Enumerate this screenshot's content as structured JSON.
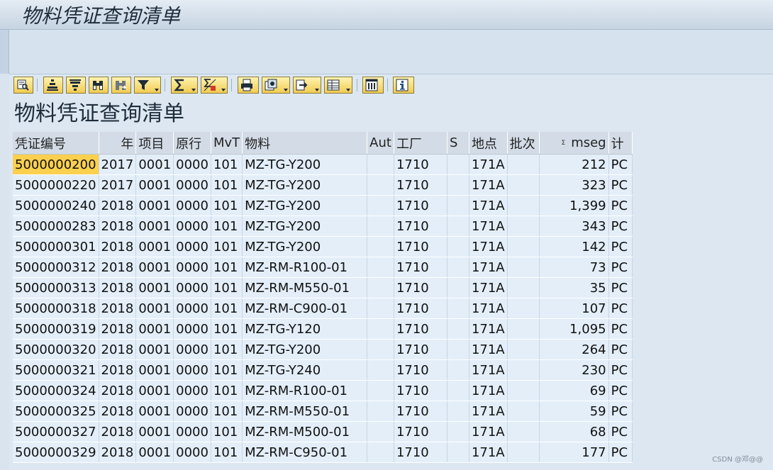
{
  "window": {
    "title": "物料凭证查询清单"
  },
  "report": {
    "title": "物料凭证查询清单"
  },
  "toolbar": {
    "buttons": [
      {
        "id": "details",
        "icon": "details-icon",
        "dropdown": false
      },
      {
        "id": "sort-asc",
        "icon": "sort-ascending-icon",
        "dropdown": false
      },
      {
        "id": "sort-desc",
        "icon": "sort-descending-icon",
        "dropdown": false
      },
      {
        "id": "find",
        "icon": "binoculars-icon",
        "dropdown": false
      },
      {
        "id": "find-next",
        "icon": "find-next-icon",
        "dropdown": false
      },
      {
        "id": "filter",
        "icon": "filter-icon",
        "dropdown": true
      },
      {
        "id": "total",
        "icon": "sum-icon",
        "dropdown": true
      },
      {
        "id": "subtotal",
        "icon": "subtotal-icon",
        "dropdown": true
      },
      {
        "id": "print",
        "icon": "print-icon",
        "dropdown": false
      },
      {
        "id": "views",
        "icon": "views-icon",
        "dropdown": true
      },
      {
        "id": "export",
        "icon": "export-icon",
        "dropdown": true
      },
      {
        "id": "layout",
        "icon": "layout-icon",
        "dropdown": true
      },
      {
        "id": "columns",
        "icon": "columns-icon",
        "dropdown": false
      },
      {
        "id": "info",
        "icon": "info-icon",
        "dropdown": false
      }
    ]
  },
  "table": {
    "columns": [
      "凭证编号",
      "年",
      "项目",
      "原行",
      "MvT",
      "物料",
      "Aut",
      "工厂",
      "S",
      "地点",
      "批次",
      "mseg",
      "计"
    ],
    "rows": [
      [
        "5000000200",
        "2017",
        "0001",
        "0000",
        "101",
        "MZ-TG-Y200",
        "",
        "1710",
        "",
        "171A",
        "",
        "212",
        "PC"
      ],
      [
        "5000000220",
        "2017",
        "0001",
        "0000",
        "101",
        "MZ-TG-Y200",
        "",
        "1710",
        "",
        "171A",
        "",
        "323",
        "PC"
      ],
      [
        "5000000240",
        "2018",
        "0001",
        "0000",
        "101",
        "MZ-TG-Y200",
        "",
        "1710",
        "",
        "171A",
        "",
        "1,399",
        "PC"
      ],
      [
        "5000000283",
        "2018",
        "0001",
        "0000",
        "101",
        "MZ-TG-Y200",
        "",
        "1710",
        "",
        "171A",
        "",
        "343",
        "PC"
      ],
      [
        "5000000301",
        "2018",
        "0001",
        "0000",
        "101",
        "MZ-TG-Y200",
        "",
        "1710",
        "",
        "171A",
        "",
        "142",
        "PC"
      ],
      [
        "5000000312",
        "2018",
        "0001",
        "0000",
        "101",
        "MZ-RM-R100-01",
        "",
        "1710",
        "",
        "171A",
        "",
        "73",
        "PC"
      ],
      [
        "5000000313",
        "2018",
        "0001",
        "0000",
        "101",
        "MZ-RM-M550-01",
        "",
        "1710",
        "",
        "171A",
        "",
        "35",
        "PC"
      ],
      [
        "5000000318",
        "2018",
        "0001",
        "0000",
        "101",
        "MZ-RM-C900-01",
        "",
        "1710",
        "",
        "171A",
        "",
        "107",
        "PC"
      ],
      [
        "5000000319",
        "2018",
        "0001",
        "0000",
        "101",
        "MZ-TG-Y120",
        "",
        "1710",
        "",
        "171A",
        "",
        "1,095",
        "PC"
      ],
      [
        "5000000320",
        "2018",
        "0001",
        "0000",
        "101",
        "MZ-TG-Y200",
        "",
        "1710",
        "",
        "171A",
        "",
        "264",
        "PC"
      ],
      [
        "5000000321",
        "2018",
        "0001",
        "0000",
        "101",
        "MZ-TG-Y240",
        "",
        "1710",
        "",
        "171A",
        "",
        "230",
        "PC"
      ],
      [
        "5000000324",
        "2018",
        "0001",
        "0000",
        "101",
        "MZ-RM-R100-01",
        "",
        "1710",
        "",
        "171A",
        "",
        "69",
        "PC"
      ],
      [
        "5000000325",
        "2018",
        "0001",
        "0000",
        "101",
        "MZ-RM-M550-01",
        "",
        "1710",
        "",
        "171A",
        "",
        "59",
        "PC"
      ],
      [
        "5000000327",
        "2018",
        "0001",
        "0000",
        "101",
        "MZ-RM-M500-01",
        "",
        "1710",
        "",
        "171A",
        "",
        "68",
        "PC"
      ],
      [
        "5000000329",
        "2018",
        "0001",
        "0000",
        "101",
        "MZ-RM-C950-01",
        "",
        "1710",
        "",
        "171A",
        "",
        "177",
        "PC"
      ]
    ],
    "selected_cell": "5000000200"
  },
  "watermark": "CSDN @邓@@",
  "colors": {
    "toolbar_button": "#f1cc52",
    "selection": "#fbd04e",
    "header": "#d3dce6",
    "cell": "#e3eef9"
  }
}
